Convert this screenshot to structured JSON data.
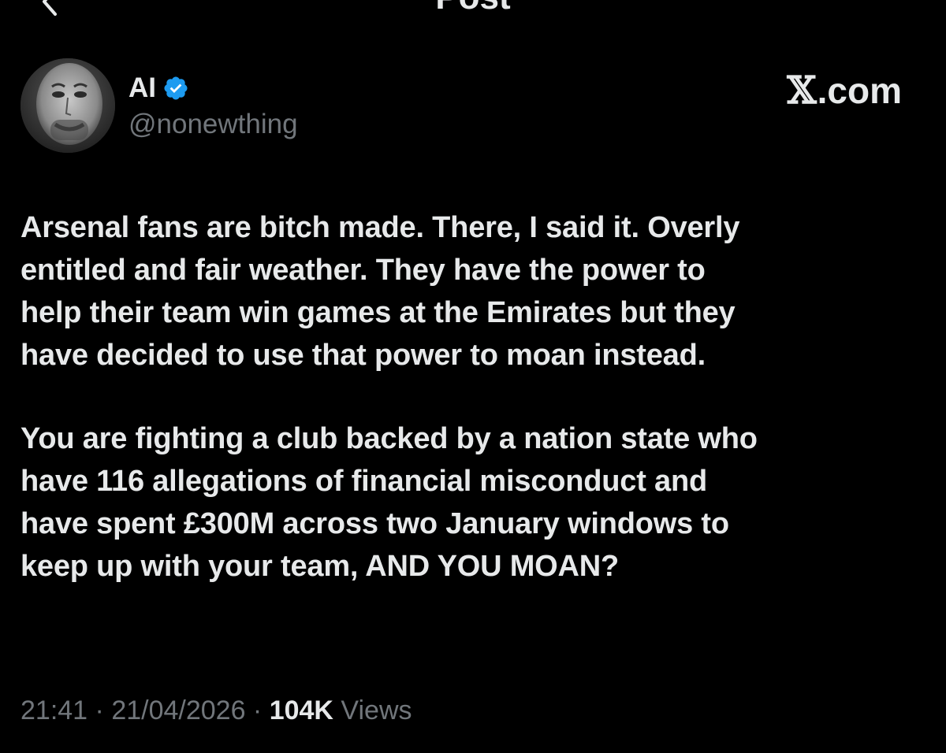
{
  "header": {
    "title": "Post"
  },
  "author": {
    "display_name": "AI",
    "handle": "@nonewthing",
    "verified": true,
    "verified_color": "#1d9bf0"
  },
  "brand": {
    "x_glyph": "𝕏",
    "suffix": ".com"
  },
  "post": {
    "paragraphs": [
      "Arsenal fans are bitch made. There, I said it. Overly\nentitled and fair weather. They have the power to\nhelp their team win games at the Emirates but they\nhave decided to use that power to moan instead.",
      "You are fighting a club backed by a nation state who\nhave 116 allegations of financial misconduct and\nhave spent £300M across two January windows to\nkeep up with your team, AND YOU MOAN?"
    ]
  },
  "meta": {
    "time": "21:41",
    "separator": " · ",
    "date": "21/04/2026",
    "views_count": "104K",
    "views_label": " Views"
  },
  "colors": {
    "background": "#000000",
    "text": "#e7e9ea",
    "secondary": "#71767b"
  }
}
